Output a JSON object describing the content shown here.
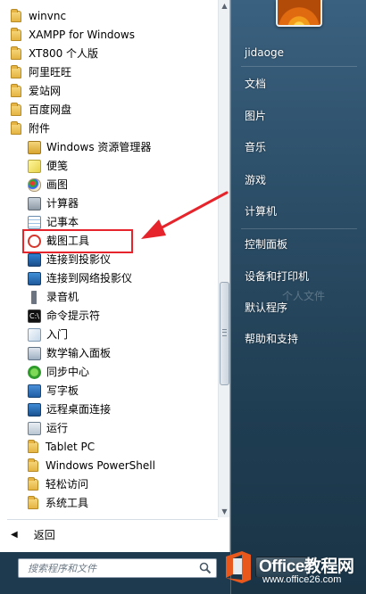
{
  "colors": {
    "accent_red": "#e6242b",
    "office_orange": "#e8581c"
  },
  "programs": [
    {
      "label": "winvnc",
      "icon": "folder-icon",
      "top": 0
    },
    {
      "label": "XAMPP for Windows",
      "icon": "folder-icon"
    },
    {
      "label": "XT800 个人版",
      "icon": "folder-icon"
    },
    {
      "label": "阿里旺旺",
      "icon": "folder-icon"
    },
    {
      "label": "爱站网",
      "icon": "folder-icon"
    },
    {
      "label": "百度网盘",
      "icon": "folder-icon"
    },
    {
      "label": "附件",
      "icon": "folder-icon"
    }
  ],
  "accessories": [
    {
      "label": "Windows 资源管理器",
      "icon": "explorer-icon"
    },
    {
      "label": "便笺",
      "icon": "sticky-notes-icon"
    },
    {
      "label": "画图",
      "icon": "paint-icon"
    },
    {
      "label": "计算器",
      "icon": "calculator-icon"
    },
    {
      "label": "记事本",
      "icon": "notepad-icon"
    },
    {
      "label": "截图工具",
      "icon": "snipping-tool-icon"
    },
    {
      "label": "连接到投影仪",
      "icon": "projector-icon"
    },
    {
      "label": "连接到网络投影仪",
      "icon": "network-projector-icon"
    },
    {
      "label": "录音机",
      "icon": "sound-recorder-icon"
    },
    {
      "label": "命令提示符",
      "icon": "cmd-icon"
    },
    {
      "label": "入门",
      "icon": "getting-started-icon"
    },
    {
      "label": "数学输入面板",
      "icon": "math-input-icon"
    },
    {
      "label": "同步中心",
      "icon": "sync-center-icon"
    },
    {
      "label": "写字板",
      "icon": "wordpad-icon"
    },
    {
      "label": "远程桌面连接",
      "icon": "remote-desktop-icon"
    },
    {
      "label": "运行",
      "icon": "run-icon"
    },
    {
      "label": "Tablet PC",
      "icon": "folder-icon"
    },
    {
      "label": "Windows PowerShell",
      "icon": "folder-icon"
    },
    {
      "label": "轻松访问",
      "icon": "folder-icon"
    },
    {
      "label": "系统工具",
      "icon": "folder-icon"
    }
  ],
  "back_label": "返回",
  "search": {
    "placeholder": "搜索程序和文件"
  },
  "right_menu": {
    "user": "jidaoge",
    "items": [
      "文档",
      "图片",
      "音乐",
      "游戏",
      "计算机",
      "控制面板",
      "设备和打印机",
      "默认程序",
      "帮助和支持"
    ],
    "faded_label": "个人文件"
  },
  "watermark": {
    "title": "Office教程网",
    "url": "www.office26.com"
  }
}
